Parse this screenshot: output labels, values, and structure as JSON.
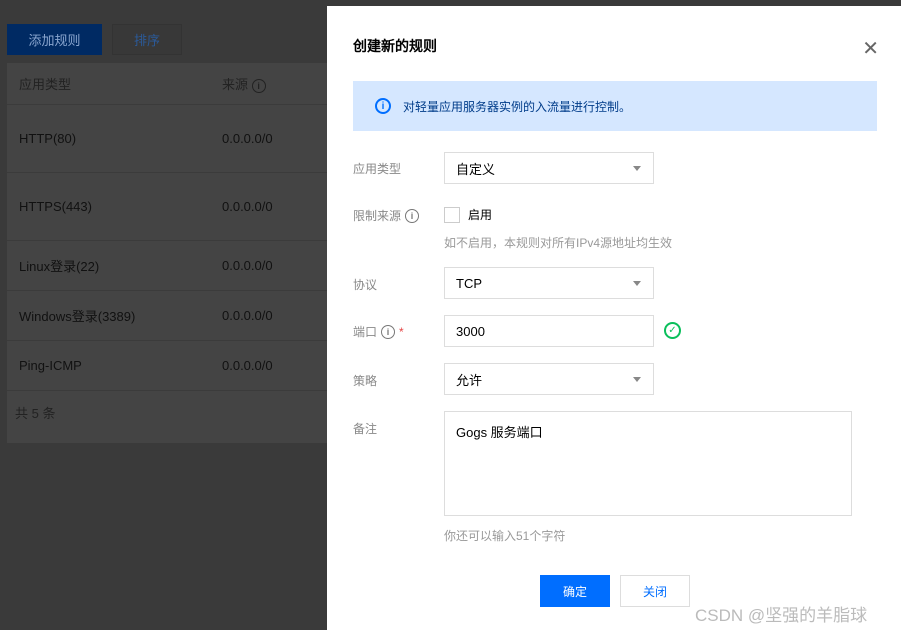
{
  "background": {
    "add_rule": "添加规则",
    "sort": "排序",
    "columns": [
      "应用类型",
      "来源"
    ],
    "rows": [
      {
        "type": "HTTP(80)",
        "source": "0.0.0.0/0"
      },
      {
        "type": "HTTPS(443)",
        "source": "0.0.0.0/0"
      },
      {
        "type": "Linux登录(22)",
        "source": "0.0.0.0/0"
      },
      {
        "type": "Windows登录(3389)",
        "source": "0.0.0.0/0"
      },
      {
        "type": "Ping-ICMP",
        "source": "0.0.0.0/0"
      }
    ],
    "total": "共 5 条"
  },
  "modal": {
    "title": "创建新的规则",
    "close": "✕",
    "info": "对轻量应用服务器实例的入流量进行控制。",
    "app_type_label": "应用类型",
    "app_type_value": "自定义",
    "limit_source_label": "限制来源",
    "enable_label": "启用",
    "enable_hint": "如不启用，本规则对所有IPv4源地址均生效",
    "protocol_label": "协议",
    "protocol_value": "TCP",
    "port_label": "端口",
    "required": "*",
    "port_value": "3000",
    "policy_label": "策略",
    "policy_value": "允许",
    "remark_label": "备注",
    "remark_value": "Gogs 服务端口",
    "remark_hint": "你还可以输入51个字符",
    "ok": "确定",
    "cancel": "关闭"
  },
  "watermark": "CSDN @坚强的羊脂球"
}
